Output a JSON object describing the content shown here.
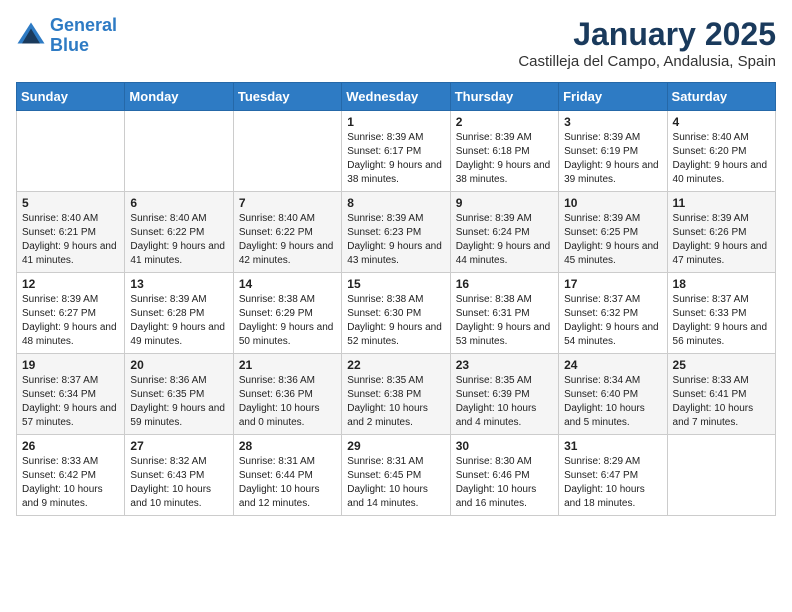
{
  "header": {
    "logo_line1": "General",
    "logo_line2": "Blue",
    "month_year": "January 2025",
    "location": "Castilleja del Campo, Andalusia, Spain"
  },
  "weekdays": [
    "Sunday",
    "Monday",
    "Tuesday",
    "Wednesday",
    "Thursday",
    "Friday",
    "Saturday"
  ],
  "weeks": [
    [
      {
        "day": "",
        "info": ""
      },
      {
        "day": "",
        "info": ""
      },
      {
        "day": "",
        "info": ""
      },
      {
        "day": "1",
        "info": "Sunrise: 8:39 AM\nSunset: 6:17 PM\nDaylight: 9 hours\nand 38 minutes."
      },
      {
        "day": "2",
        "info": "Sunrise: 8:39 AM\nSunset: 6:18 PM\nDaylight: 9 hours\nand 38 minutes."
      },
      {
        "day": "3",
        "info": "Sunrise: 8:39 AM\nSunset: 6:19 PM\nDaylight: 9 hours\nand 39 minutes."
      },
      {
        "day": "4",
        "info": "Sunrise: 8:40 AM\nSunset: 6:20 PM\nDaylight: 9 hours\nand 40 minutes."
      }
    ],
    [
      {
        "day": "5",
        "info": "Sunrise: 8:40 AM\nSunset: 6:21 PM\nDaylight: 9 hours\nand 41 minutes."
      },
      {
        "day": "6",
        "info": "Sunrise: 8:40 AM\nSunset: 6:22 PM\nDaylight: 9 hours\nand 41 minutes."
      },
      {
        "day": "7",
        "info": "Sunrise: 8:40 AM\nSunset: 6:22 PM\nDaylight: 9 hours\nand 42 minutes."
      },
      {
        "day": "8",
        "info": "Sunrise: 8:39 AM\nSunset: 6:23 PM\nDaylight: 9 hours\nand 43 minutes."
      },
      {
        "day": "9",
        "info": "Sunrise: 8:39 AM\nSunset: 6:24 PM\nDaylight: 9 hours\nand 44 minutes."
      },
      {
        "day": "10",
        "info": "Sunrise: 8:39 AM\nSunset: 6:25 PM\nDaylight: 9 hours\nand 45 minutes."
      },
      {
        "day": "11",
        "info": "Sunrise: 8:39 AM\nSunset: 6:26 PM\nDaylight: 9 hours\nand 47 minutes."
      }
    ],
    [
      {
        "day": "12",
        "info": "Sunrise: 8:39 AM\nSunset: 6:27 PM\nDaylight: 9 hours\nand 48 minutes."
      },
      {
        "day": "13",
        "info": "Sunrise: 8:39 AM\nSunset: 6:28 PM\nDaylight: 9 hours\nand 49 minutes."
      },
      {
        "day": "14",
        "info": "Sunrise: 8:38 AM\nSunset: 6:29 PM\nDaylight: 9 hours\nand 50 minutes."
      },
      {
        "day": "15",
        "info": "Sunrise: 8:38 AM\nSunset: 6:30 PM\nDaylight: 9 hours\nand 52 minutes."
      },
      {
        "day": "16",
        "info": "Sunrise: 8:38 AM\nSunset: 6:31 PM\nDaylight: 9 hours\nand 53 minutes."
      },
      {
        "day": "17",
        "info": "Sunrise: 8:37 AM\nSunset: 6:32 PM\nDaylight: 9 hours\nand 54 minutes."
      },
      {
        "day": "18",
        "info": "Sunrise: 8:37 AM\nSunset: 6:33 PM\nDaylight: 9 hours\nand 56 minutes."
      }
    ],
    [
      {
        "day": "19",
        "info": "Sunrise: 8:37 AM\nSunset: 6:34 PM\nDaylight: 9 hours\nand 57 minutes."
      },
      {
        "day": "20",
        "info": "Sunrise: 8:36 AM\nSunset: 6:35 PM\nDaylight: 9 hours\nand 59 minutes."
      },
      {
        "day": "21",
        "info": "Sunrise: 8:36 AM\nSunset: 6:36 PM\nDaylight: 10 hours\nand 0 minutes."
      },
      {
        "day": "22",
        "info": "Sunrise: 8:35 AM\nSunset: 6:38 PM\nDaylight: 10 hours\nand 2 minutes."
      },
      {
        "day": "23",
        "info": "Sunrise: 8:35 AM\nSunset: 6:39 PM\nDaylight: 10 hours\nand 4 minutes."
      },
      {
        "day": "24",
        "info": "Sunrise: 8:34 AM\nSunset: 6:40 PM\nDaylight: 10 hours\nand 5 minutes."
      },
      {
        "day": "25",
        "info": "Sunrise: 8:33 AM\nSunset: 6:41 PM\nDaylight: 10 hours\nand 7 minutes."
      }
    ],
    [
      {
        "day": "26",
        "info": "Sunrise: 8:33 AM\nSunset: 6:42 PM\nDaylight: 10 hours\nand 9 minutes."
      },
      {
        "day": "27",
        "info": "Sunrise: 8:32 AM\nSunset: 6:43 PM\nDaylight: 10 hours\nand 10 minutes."
      },
      {
        "day": "28",
        "info": "Sunrise: 8:31 AM\nSunset: 6:44 PM\nDaylight: 10 hours\nand 12 minutes."
      },
      {
        "day": "29",
        "info": "Sunrise: 8:31 AM\nSunset: 6:45 PM\nDaylight: 10 hours\nand 14 minutes."
      },
      {
        "day": "30",
        "info": "Sunrise: 8:30 AM\nSunset: 6:46 PM\nDaylight: 10 hours\nand 16 minutes."
      },
      {
        "day": "31",
        "info": "Sunrise: 8:29 AM\nSunset: 6:47 PM\nDaylight: 10 hours\nand 18 minutes."
      },
      {
        "day": "",
        "info": ""
      }
    ]
  ]
}
